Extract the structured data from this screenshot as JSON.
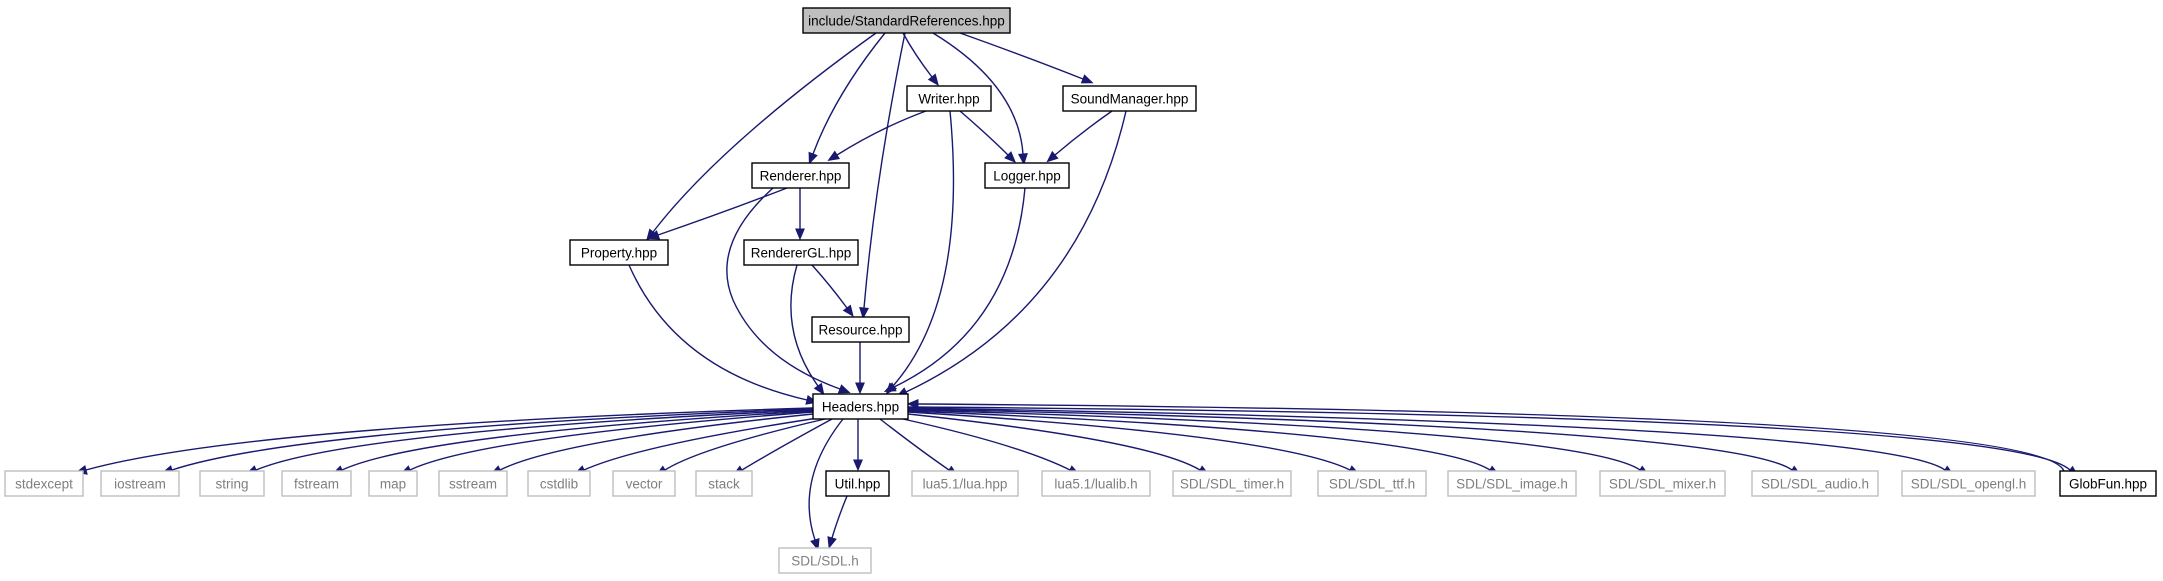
{
  "diagram": {
    "type": "include-dependency-graph",
    "colors": {
      "edge": "#191970",
      "documented_border": "#000000",
      "external_border": "#bfbfbf",
      "external_text": "#7f7f7f",
      "root_fill": "#bfbfbf"
    },
    "nodes": [
      {
        "id": "standard_references",
        "label": "include/StandardReferences.hpp",
        "kind": "root"
      },
      {
        "id": "writer",
        "label": "Writer.hpp",
        "kind": "documented"
      },
      {
        "id": "sound_manager",
        "label": "SoundManager.hpp",
        "kind": "documented"
      },
      {
        "id": "renderer",
        "label": "Renderer.hpp",
        "kind": "documented"
      },
      {
        "id": "logger",
        "label": "Logger.hpp",
        "kind": "documented"
      },
      {
        "id": "property",
        "label": "Property.hpp",
        "kind": "documented"
      },
      {
        "id": "renderer_gl",
        "label": "RendererGL.hpp",
        "kind": "documented"
      },
      {
        "id": "resource",
        "label": "Resource.hpp",
        "kind": "documented"
      },
      {
        "id": "headers",
        "label": "Headers.hpp",
        "kind": "documented"
      },
      {
        "id": "stdexcept",
        "label": "stdexcept",
        "kind": "external"
      },
      {
        "id": "iostream",
        "label": "iostream",
        "kind": "external"
      },
      {
        "id": "string",
        "label": "string",
        "kind": "external"
      },
      {
        "id": "fstream",
        "label": "fstream",
        "kind": "external"
      },
      {
        "id": "map",
        "label": "map",
        "kind": "external"
      },
      {
        "id": "sstream",
        "label": "sstream",
        "kind": "external"
      },
      {
        "id": "cstdlib",
        "label": "cstdlib",
        "kind": "external"
      },
      {
        "id": "vector",
        "label": "vector",
        "kind": "external"
      },
      {
        "id": "stack",
        "label": "stack",
        "kind": "external"
      },
      {
        "id": "util",
        "label": "Util.hpp",
        "kind": "documented"
      },
      {
        "id": "lua",
        "label": "lua5.1/lua.hpp",
        "kind": "external"
      },
      {
        "id": "lualib",
        "label": "lua5.1/lualib.h",
        "kind": "external"
      },
      {
        "id": "sdl_timer",
        "label": "SDL/SDL_timer.h",
        "kind": "external"
      },
      {
        "id": "sdl_ttf",
        "label": "SDL/SDL_ttf.h",
        "kind": "external"
      },
      {
        "id": "sdl_image",
        "label": "SDL/SDL_image.h",
        "kind": "external"
      },
      {
        "id": "sdl_mixer",
        "label": "SDL/SDL_mixer.h",
        "kind": "external"
      },
      {
        "id": "sdl_audio",
        "label": "SDL/SDL_audio.h",
        "kind": "external"
      },
      {
        "id": "sdl_opengl",
        "label": "SDL/SDL_opengl.h",
        "kind": "external"
      },
      {
        "id": "glob_fun",
        "label": "GlobFun.hpp",
        "kind": "documented"
      },
      {
        "id": "sdl",
        "label": "SDL/SDL.h",
        "kind": "external"
      }
    ],
    "edges": [
      [
        "standard_references",
        "writer"
      ],
      [
        "standard_references",
        "sound_manager"
      ],
      [
        "standard_references",
        "renderer"
      ],
      [
        "standard_references",
        "logger"
      ],
      [
        "standard_references",
        "property"
      ],
      [
        "standard_references",
        "resource"
      ],
      [
        "writer",
        "renderer"
      ],
      [
        "writer",
        "logger"
      ],
      [
        "writer",
        "headers"
      ],
      [
        "sound_manager",
        "logger"
      ],
      [
        "sound_manager",
        "headers"
      ],
      [
        "renderer",
        "property"
      ],
      [
        "renderer",
        "renderer_gl"
      ],
      [
        "renderer",
        "headers"
      ],
      [
        "logger",
        "headers"
      ],
      [
        "property",
        "headers"
      ],
      [
        "renderer_gl",
        "resource"
      ],
      [
        "renderer_gl",
        "headers"
      ],
      [
        "resource",
        "headers"
      ],
      [
        "headers",
        "stdexcept"
      ],
      [
        "headers",
        "iostream"
      ],
      [
        "headers",
        "string"
      ],
      [
        "headers",
        "fstream"
      ],
      [
        "headers",
        "map"
      ],
      [
        "headers",
        "sstream"
      ],
      [
        "headers",
        "cstdlib"
      ],
      [
        "headers",
        "vector"
      ],
      [
        "headers",
        "stack"
      ],
      [
        "headers",
        "util"
      ],
      [
        "headers",
        "sdl"
      ],
      [
        "headers",
        "lua"
      ],
      [
        "headers",
        "lualib"
      ],
      [
        "headers",
        "sdl_timer"
      ],
      [
        "headers",
        "sdl_ttf"
      ],
      [
        "headers",
        "sdl_image"
      ],
      [
        "headers",
        "sdl_mixer"
      ],
      [
        "headers",
        "sdl_audio"
      ],
      [
        "headers",
        "sdl_opengl"
      ],
      [
        "headers",
        "glob_fun"
      ],
      [
        "glob_fun",
        "headers"
      ],
      [
        "util",
        "sdl"
      ]
    ]
  }
}
